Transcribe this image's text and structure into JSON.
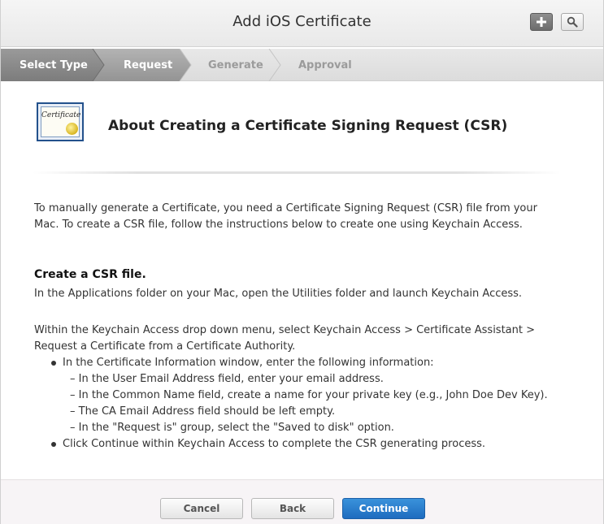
{
  "window": {
    "title": "Add iOS Certificate"
  },
  "toolbar": {
    "add_icon": "plus-icon",
    "search_icon": "search-icon"
  },
  "steps": [
    {
      "label": "Select Type",
      "state": "done"
    },
    {
      "label": "Request",
      "state": "current"
    },
    {
      "label": "Generate",
      "state": "upcoming"
    },
    {
      "label": "Approval",
      "state": "upcoming"
    }
  ],
  "header": {
    "icon": "certificate-icon",
    "icon_word": "Certificate",
    "heading": "About Creating a Certificate Signing Request (CSR)"
  },
  "intro": {
    "line1": "To manually generate a Certificate, you need a Certificate Signing Request (CSR) file from your",
    "line2": "Mac. To create a CSR file, follow the instructions below to create one using Keychain Access."
  },
  "section": {
    "heading": "Create a CSR file.",
    "line1": "In the Applications folder on your Mac, open the Utilities folder and launch Keychain Access.",
    "para2_line1": "Within the Keychain Access drop down menu, select Keychain Access > Certificate Assistant >",
    "para2_line2": "Request a Certificate from a Certificate Authority.",
    "bullet1": "In the Certificate Information window, enter the following information:",
    "sub1": "– In the User Email Address field, enter your email address.",
    "sub2": "– In the Common Name field, create a name for your private key (e.g., John Doe Dev Key).",
    "sub3": "– The CA Email Address field should be left empty.",
    "sub4": "– In the \"Request is\" group, select the \"Saved to disk\" option.",
    "bullet2": "Click Continue within Keychain Access to complete the CSR generating process."
  },
  "footer": {
    "cancel": "Cancel",
    "back": "Back",
    "continue": "Continue"
  },
  "colors": {
    "step_done_bg": "#8a8a8a",
    "step_current_bg": "#a3a3a3",
    "primary_button": "#2a7fd0"
  }
}
